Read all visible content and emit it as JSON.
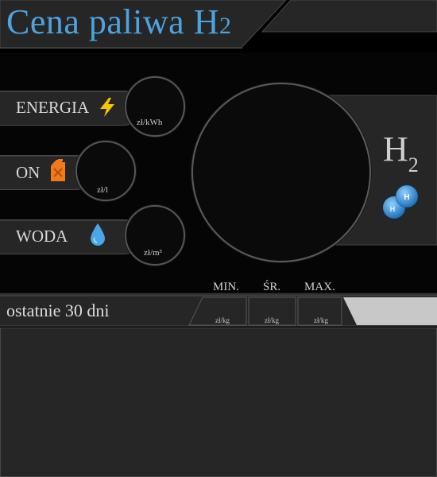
{
  "header": {
    "title_main": "Cena paliwa H",
    "title_sub": "2"
  },
  "fuels": [
    {
      "label": "ENERGIA",
      "unit": "zł/kWh",
      "icon": "lightning-icon",
      "icon_color": "#f5c400"
    },
    {
      "label": "ON",
      "unit": "zł/l",
      "icon": "fuel-canister-icon",
      "icon_color": "#f07a1c"
    },
    {
      "label": "WODA",
      "unit": "zł/m³",
      "icon": "water-drop-icon",
      "icon_color": "#4aa6e6"
    }
  ],
  "h2_panel": {
    "symbol": "H",
    "subscript": "2",
    "molecule_atom": "H"
  },
  "stats": {
    "period_label": "ostatnie 30 dni",
    "columns": [
      {
        "label": "MIN.",
        "unit": "zł/kg"
      },
      {
        "label": "ŚR.",
        "unit": "zł/kg"
      },
      {
        "label": "MAX.",
        "unit": "zł/kg"
      }
    ]
  },
  "colors": {
    "accent": "#4da3e0",
    "panel": "#262626",
    "background": "#000000"
  }
}
